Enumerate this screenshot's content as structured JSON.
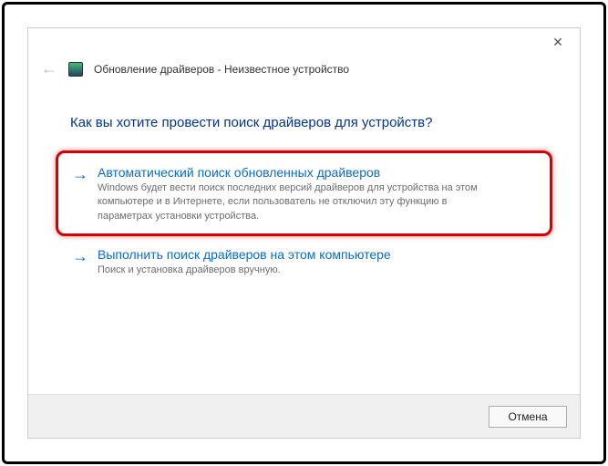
{
  "titlebar": {
    "close_symbol": "✕"
  },
  "header": {
    "back_symbol": "←",
    "wizard_title": "Обновление драйверов - Неизвестное устройство"
  },
  "question": "Как вы хотите провести поиск драйверов для устройств?",
  "options": [
    {
      "arrow": "→",
      "title": "Автоматический поиск обновленных драйверов",
      "desc": "Windows будет вести поиск последних версий драйверов для устройства на этом компьютере и в Интернете, если пользователь не отключил эту функцию в параметрах установки устройства."
    },
    {
      "arrow": "→",
      "title": "Выполнить поиск драйверов на этом компьютере",
      "desc": "Поиск и установка драйверов вручную."
    }
  ],
  "footer": {
    "cancel_label": "Отмена"
  }
}
